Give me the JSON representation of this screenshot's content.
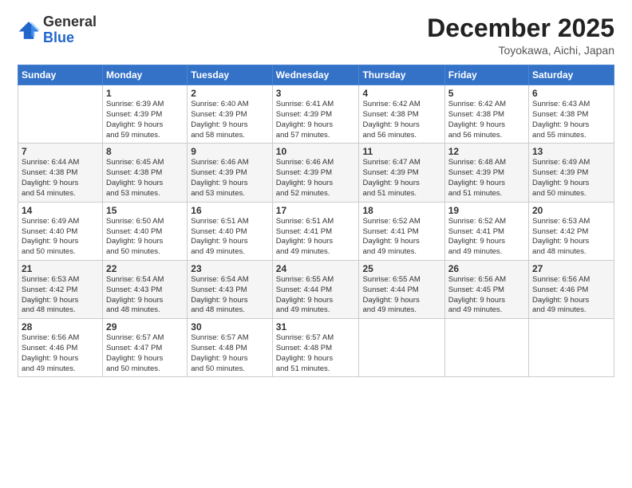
{
  "logo": {
    "general": "General",
    "blue": "Blue"
  },
  "header": {
    "month": "December 2025",
    "location": "Toyokawa, Aichi, Japan"
  },
  "weekdays": [
    "Sunday",
    "Monday",
    "Tuesday",
    "Wednesday",
    "Thursday",
    "Friday",
    "Saturday"
  ],
  "weeks": [
    [
      {
        "day": "",
        "info": ""
      },
      {
        "day": "1",
        "info": "Sunrise: 6:39 AM\nSunset: 4:39 PM\nDaylight: 9 hours\nand 59 minutes."
      },
      {
        "day": "2",
        "info": "Sunrise: 6:40 AM\nSunset: 4:39 PM\nDaylight: 9 hours\nand 58 minutes."
      },
      {
        "day": "3",
        "info": "Sunrise: 6:41 AM\nSunset: 4:39 PM\nDaylight: 9 hours\nand 57 minutes."
      },
      {
        "day": "4",
        "info": "Sunrise: 6:42 AM\nSunset: 4:38 PM\nDaylight: 9 hours\nand 56 minutes."
      },
      {
        "day": "5",
        "info": "Sunrise: 6:42 AM\nSunset: 4:38 PM\nDaylight: 9 hours\nand 56 minutes."
      },
      {
        "day": "6",
        "info": "Sunrise: 6:43 AM\nSunset: 4:38 PM\nDaylight: 9 hours\nand 55 minutes."
      }
    ],
    [
      {
        "day": "7",
        "info": "Sunrise: 6:44 AM\nSunset: 4:38 PM\nDaylight: 9 hours\nand 54 minutes."
      },
      {
        "day": "8",
        "info": "Sunrise: 6:45 AM\nSunset: 4:38 PM\nDaylight: 9 hours\nand 53 minutes."
      },
      {
        "day": "9",
        "info": "Sunrise: 6:46 AM\nSunset: 4:39 PM\nDaylight: 9 hours\nand 53 minutes."
      },
      {
        "day": "10",
        "info": "Sunrise: 6:46 AM\nSunset: 4:39 PM\nDaylight: 9 hours\nand 52 minutes."
      },
      {
        "day": "11",
        "info": "Sunrise: 6:47 AM\nSunset: 4:39 PM\nDaylight: 9 hours\nand 51 minutes."
      },
      {
        "day": "12",
        "info": "Sunrise: 6:48 AM\nSunset: 4:39 PM\nDaylight: 9 hours\nand 51 minutes."
      },
      {
        "day": "13",
        "info": "Sunrise: 6:49 AM\nSunset: 4:39 PM\nDaylight: 9 hours\nand 50 minutes."
      }
    ],
    [
      {
        "day": "14",
        "info": "Sunrise: 6:49 AM\nSunset: 4:40 PM\nDaylight: 9 hours\nand 50 minutes."
      },
      {
        "day": "15",
        "info": "Sunrise: 6:50 AM\nSunset: 4:40 PM\nDaylight: 9 hours\nand 50 minutes."
      },
      {
        "day": "16",
        "info": "Sunrise: 6:51 AM\nSunset: 4:40 PM\nDaylight: 9 hours\nand 49 minutes."
      },
      {
        "day": "17",
        "info": "Sunrise: 6:51 AM\nSunset: 4:41 PM\nDaylight: 9 hours\nand 49 minutes."
      },
      {
        "day": "18",
        "info": "Sunrise: 6:52 AM\nSunset: 4:41 PM\nDaylight: 9 hours\nand 49 minutes."
      },
      {
        "day": "19",
        "info": "Sunrise: 6:52 AM\nSunset: 4:41 PM\nDaylight: 9 hours\nand 49 minutes."
      },
      {
        "day": "20",
        "info": "Sunrise: 6:53 AM\nSunset: 4:42 PM\nDaylight: 9 hours\nand 48 minutes."
      }
    ],
    [
      {
        "day": "21",
        "info": "Sunrise: 6:53 AM\nSunset: 4:42 PM\nDaylight: 9 hours\nand 48 minutes."
      },
      {
        "day": "22",
        "info": "Sunrise: 6:54 AM\nSunset: 4:43 PM\nDaylight: 9 hours\nand 48 minutes."
      },
      {
        "day": "23",
        "info": "Sunrise: 6:54 AM\nSunset: 4:43 PM\nDaylight: 9 hours\nand 48 minutes."
      },
      {
        "day": "24",
        "info": "Sunrise: 6:55 AM\nSunset: 4:44 PM\nDaylight: 9 hours\nand 49 minutes."
      },
      {
        "day": "25",
        "info": "Sunrise: 6:55 AM\nSunset: 4:44 PM\nDaylight: 9 hours\nand 49 minutes."
      },
      {
        "day": "26",
        "info": "Sunrise: 6:56 AM\nSunset: 4:45 PM\nDaylight: 9 hours\nand 49 minutes."
      },
      {
        "day": "27",
        "info": "Sunrise: 6:56 AM\nSunset: 4:46 PM\nDaylight: 9 hours\nand 49 minutes."
      }
    ],
    [
      {
        "day": "28",
        "info": "Sunrise: 6:56 AM\nSunset: 4:46 PM\nDaylight: 9 hours\nand 49 minutes."
      },
      {
        "day": "29",
        "info": "Sunrise: 6:57 AM\nSunset: 4:47 PM\nDaylight: 9 hours\nand 50 minutes."
      },
      {
        "day": "30",
        "info": "Sunrise: 6:57 AM\nSunset: 4:48 PM\nDaylight: 9 hours\nand 50 minutes."
      },
      {
        "day": "31",
        "info": "Sunrise: 6:57 AM\nSunset: 4:48 PM\nDaylight: 9 hours\nand 51 minutes."
      },
      {
        "day": "",
        "info": ""
      },
      {
        "day": "",
        "info": ""
      },
      {
        "day": "",
        "info": ""
      }
    ]
  ]
}
